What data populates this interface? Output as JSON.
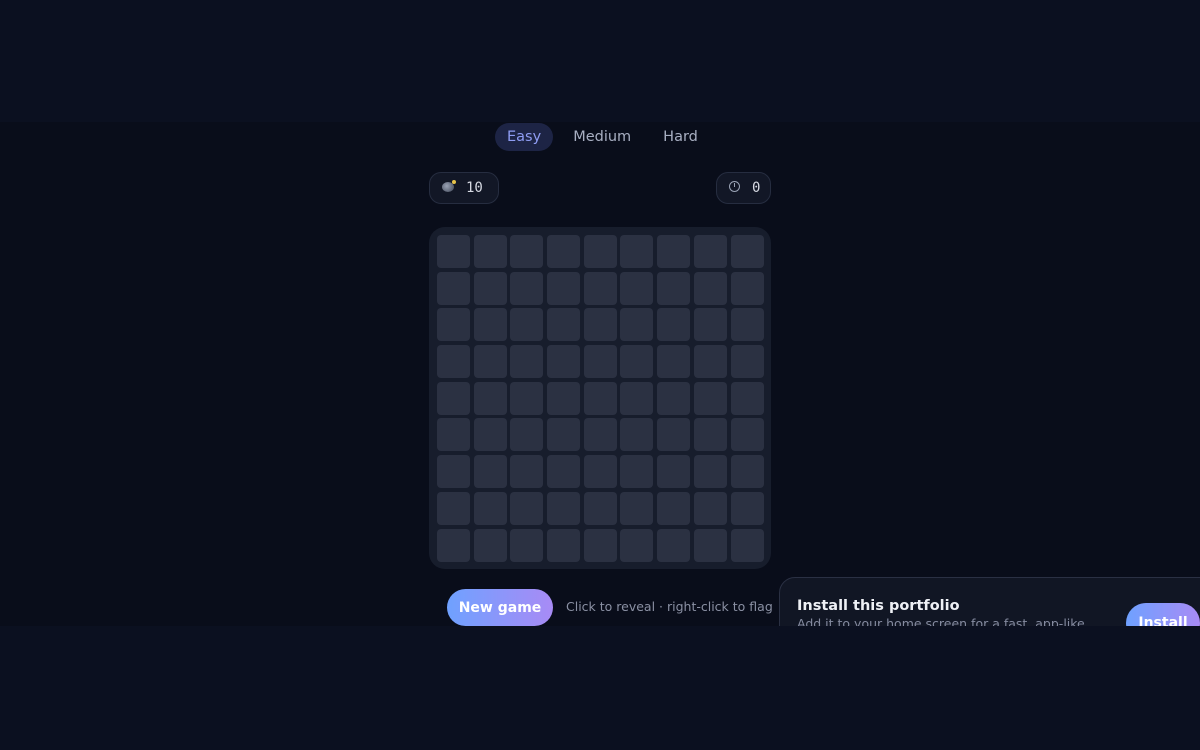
{
  "difficulty_tabs": [
    {
      "label": "Easy",
      "active": true
    },
    {
      "label": "Medium",
      "active": false
    },
    {
      "label": "Hard",
      "active": false
    }
  ],
  "mines_counter": {
    "icon": "bomb-icon",
    "value": "10"
  },
  "timer": {
    "icon": "stopwatch-icon",
    "value": "0"
  },
  "board": {
    "rows": 9,
    "cols": 9,
    "state": "all-covered"
  },
  "controls": {
    "new_game_label": "New game",
    "hint": "Click to reveal · right-click to flag"
  },
  "install_prompt": {
    "title": "Install this portfolio",
    "description": "Add it to your home screen for a fast, app-like",
    "button_label": "Install"
  },
  "colors": {
    "background": "#0b1020",
    "accent_gradient_start": "#6fa1ff",
    "accent_gradient_end": "#a88bf5",
    "active_tab_text": "#8e9cf2",
    "cell": "#2b3142"
  }
}
